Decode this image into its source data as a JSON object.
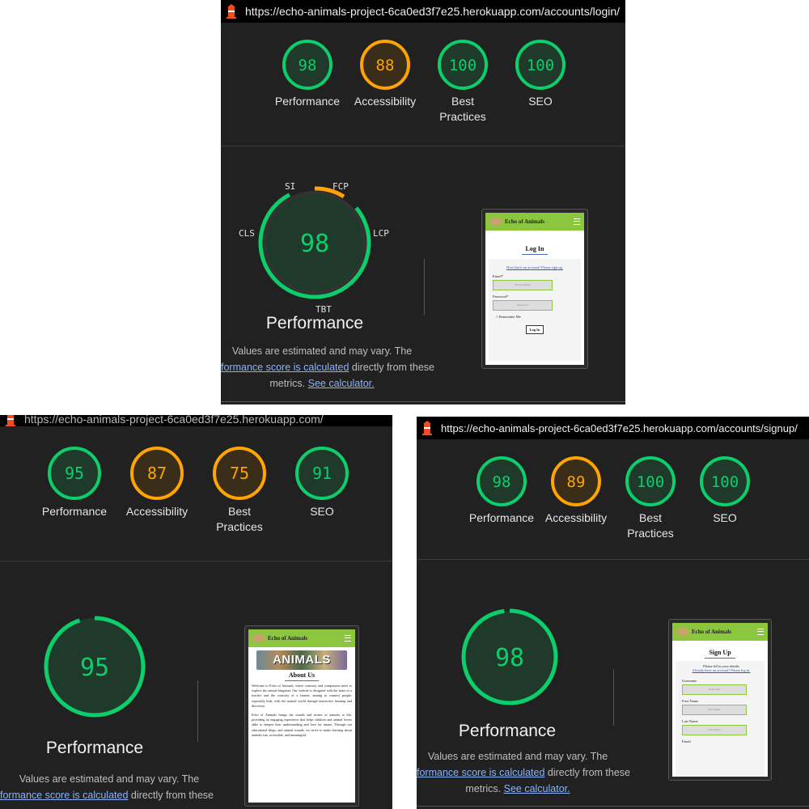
{
  "colors": {
    "pass": "#0cce6b",
    "average": "#ffa400",
    "panel_bg": "#212121",
    "link": "#8ab4f8"
  },
  "panel1": {
    "url": "https://echo-animals-project-6ca0ed3f7e25.herokuapp.com/accounts/login/",
    "scores": [
      {
        "value": "98",
        "label": "Performance",
        "status": "pass"
      },
      {
        "value": "88",
        "label": "Accessibility",
        "status": "average"
      },
      {
        "value": "100",
        "label": "Best Practices",
        "status": "pass"
      },
      {
        "value": "100",
        "label": "SEO",
        "status": "pass"
      }
    ],
    "big_score": "98",
    "metrics": {
      "si": "SI",
      "fcp": "FCP",
      "lcp": "LCP",
      "tbt": "TBT",
      "cls": "CLS"
    },
    "title": "Performance",
    "note_line1": "Values are estimated and may vary. The",
    "note_link1": "formance score is calculated",
    "note_line2_rest": " directly from these",
    "note_line3_pre": "metrics. ",
    "note_link2": "See calculator.",
    "preview": {
      "brand": "Echo of Animals",
      "heading": "Log In",
      "signup_link": "Don't have an account? Please sign up.",
      "email_label": "Email*",
      "email_placeholder": "Email address",
      "password_label": "Password*",
      "password_placeholder": "Password",
      "remember": "Remember Me",
      "button": "Log In"
    }
  },
  "panel2": {
    "url": "https://echo-animals-project-6ca0ed3f7e25.herokuapp.com/",
    "scores": [
      {
        "value": "95",
        "label": "Performance",
        "status": "pass"
      },
      {
        "value": "87",
        "label": "Accessibility",
        "status": "average"
      },
      {
        "value": "75",
        "label": "Best Practices",
        "status": "average"
      },
      {
        "value": "91",
        "label": "SEO",
        "status": "pass"
      }
    ],
    "big_score": "95",
    "title": "Performance",
    "note_line1": "Values are estimated and may vary. The",
    "note_link1": "formance score is calculated",
    "note_line2_rest": " directly from these",
    "preview": {
      "brand": "Echo of Animals",
      "banner": "ANIMALS",
      "heading": "About Us",
      "para1": "Welcome to Echo of Animals, where curiosity and compassion meet to explore the animal kingdom. Our website is designed with the heart of a teacher and the curiosity of a learner, aiming to connect people, especially kids, with the natural world through interactive learning and discovery.",
      "para2": "Echo of Animals brings the sounds and stories of animals to life, providing an engaging experience that helps children and animal lovers alike to deepen their understanding and love for nature. Through our educational blogs, and animal sounds, we strive to make learning about animals fun, accessible, and meaningful."
    }
  },
  "panel3": {
    "url": "https://echo-animals-project-6ca0ed3f7e25.herokuapp.com/accounts/signup/",
    "scores": [
      {
        "value": "98",
        "label": "Performance",
        "status": "pass"
      },
      {
        "value": "89",
        "label": "Accessibility",
        "status": "average"
      },
      {
        "value": "100",
        "label": "Best Practices",
        "status": "pass"
      },
      {
        "value": "100",
        "label": "SEO",
        "status": "pass"
      }
    ],
    "big_score": "98",
    "title": "Performance",
    "note_line1": "Values are estimated and may vary. The",
    "note_link1": "formance score is calculated",
    "note_line2_rest": " directly from these",
    "note_line3_pre": "metrics. ",
    "note_link2": "See calculator.",
    "preview": {
      "brand": "Echo of Animals",
      "heading": "Sign Up",
      "intro": "Please fill in your details",
      "login_link": "Already have an account? Please log in.",
      "username_label": "Username",
      "username_placeholder": "Username",
      "first_label": "First Name",
      "first_placeholder": "First Name",
      "last_label": "Last Name",
      "last_placeholder": "Last Name",
      "email_label": "Email"
    }
  }
}
